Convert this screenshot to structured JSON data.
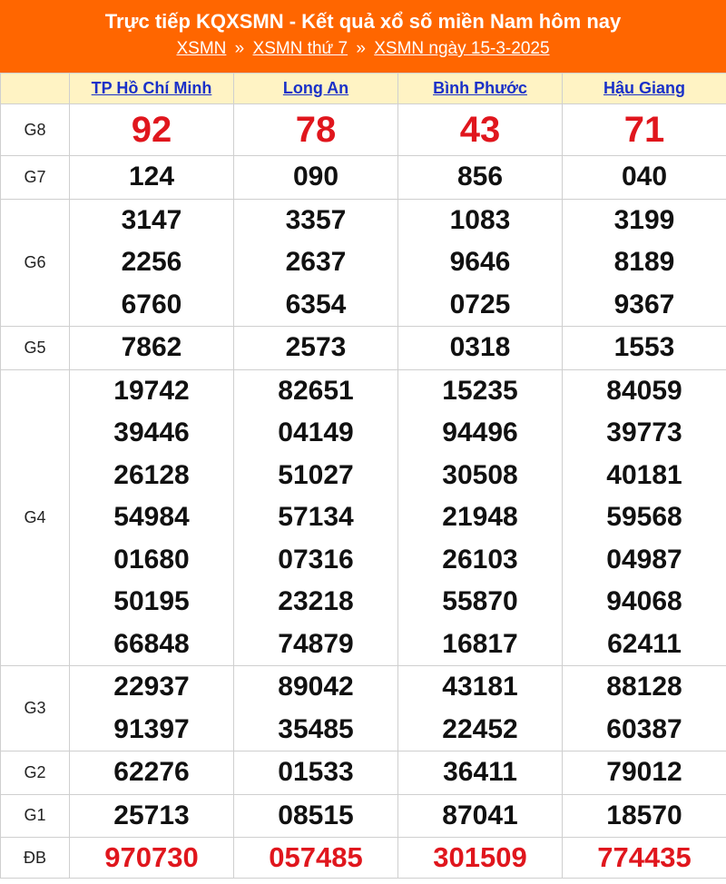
{
  "header": {
    "title": "Trực tiếp KQXSMN - Kết quả xổ số miền Nam hôm nay",
    "breadcrumbs": [
      "XSMN",
      "XSMN thứ 7",
      "XSMN ngày 15-3-2025"
    ],
    "separator": "»"
  },
  "provinces": [
    "TP Hồ Chí Minh",
    "Long An",
    "Bình Phước",
    "Hậu Giang"
  ],
  "prizes": [
    {
      "label": "G8",
      "values": [
        [
          "92"
        ],
        [
          "78"
        ],
        [
          "43"
        ],
        [
          "71"
        ]
      ]
    },
    {
      "label": "G7",
      "values": [
        [
          "124"
        ],
        [
          "090"
        ],
        [
          "856"
        ],
        [
          "040"
        ]
      ]
    },
    {
      "label": "G6",
      "values": [
        [
          "3147",
          "2256",
          "6760"
        ],
        [
          "3357",
          "2637",
          "6354"
        ],
        [
          "1083",
          "9646",
          "0725"
        ],
        [
          "3199",
          "8189",
          "9367"
        ]
      ]
    },
    {
      "label": "G5",
      "values": [
        [
          "7862"
        ],
        [
          "2573"
        ],
        [
          "0318"
        ],
        [
          "1553"
        ]
      ]
    },
    {
      "label": "G4",
      "values": [
        [
          "19742",
          "39446",
          "26128",
          "54984",
          "01680",
          "50195",
          "66848"
        ],
        [
          "82651",
          "04149",
          "51027",
          "57134",
          "07316",
          "23218",
          "74879"
        ],
        [
          "15235",
          "94496",
          "30508",
          "21948",
          "26103",
          "55870",
          "16817"
        ],
        [
          "84059",
          "39773",
          "40181",
          "59568",
          "04987",
          "94068",
          "62411"
        ]
      ]
    },
    {
      "label": "G3",
      "values": [
        [
          "22937",
          "91397"
        ],
        [
          "89042",
          "35485"
        ],
        [
          "43181",
          "22452"
        ],
        [
          "88128",
          "60387"
        ]
      ]
    },
    {
      "label": "G2",
      "values": [
        [
          "62276"
        ],
        [
          "01533"
        ],
        [
          "36411"
        ],
        [
          "79012"
        ]
      ]
    },
    {
      "label": "G1",
      "values": [
        [
          "25713"
        ],
        [
          "08515"
        ],
        [
          "87041"
        ],
        [
          "18570"
        ]
      ]
    },
    {
      "label": "ĐB",
      "values": [
        [
          "970730"
        ],
        [
          "057485"
        ],
        [
          "301509"
        ],
        [
          "774435"
        ]
      ]
    }
  ],
  "colors": {
    "header_bg": "#ff6600",
    "header_row_bg": "#fff3c4",
    "highlight_red": "#e0161d",
    "link_blue": "#1a31c8"
  }
}
